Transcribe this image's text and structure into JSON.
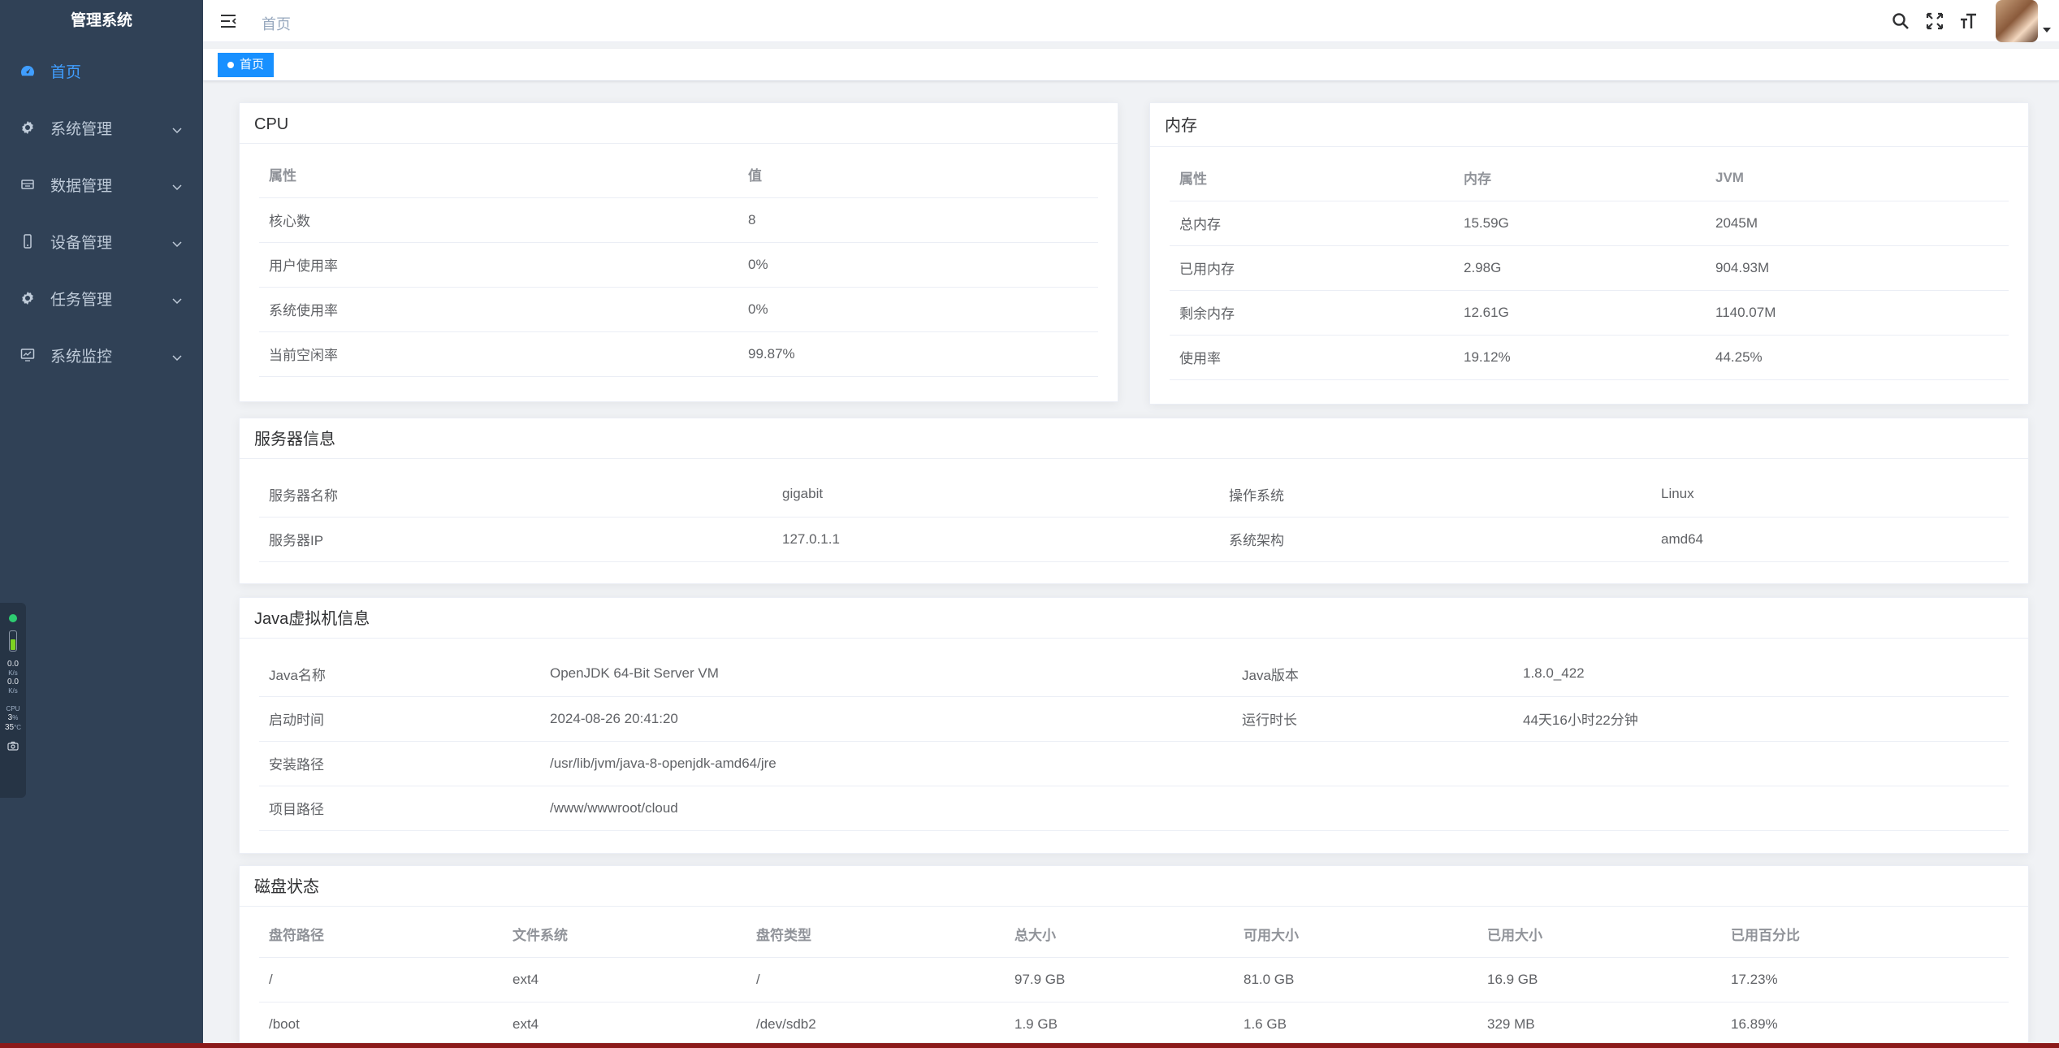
{
  "sidebar": {
    "logo": "管理系统",
    "items": [
      {
        "label": "首页",
        "icon": "dashboard-icon"
      },
      {
        "label": "系统管理",
        "icon": "gear-icon"
      },
      {
        "label": "数据管理",
        "icon": "database-icon"
      },
      {
        "label": "设备管理",
        "icon": "phone-icon"
      },
      {
        "label": "任务管理",
        "icon": "gear-icon"
      },
      {
        "label": "系统监控",
        "icon": "monitor-icon"
      }
    ]
  },
  "widget": {
    "up": "0.0",
    "up_unit": "K/s",
    "down": "0.0",
    "down_unit": "K/s",
    "cpu_label": "CPU",
    "cpu_value": "3",
    "cpu_unit": "%",
    "temp": "35",
    "temp_unit": "°C"
  },
  "header": {
    "breadcrumb": "首页",
    "tag": "首页"
  },
  "cpu": {
    "title": "CPU",
    "headers": [
      "属性",
      "值"
    ],
    "rows": [
      [
        "核心数",
        "8"
      ],
      [
        "用户使用率",
        "0%"
      ],
      [
        "系统使用率",
        "0%"
      ],
      [
        "当前空闲率",
        "99.87%"
      ]
    ]
  },
  "memory": {
    "title": "内存",
    "headers": [
      "属性",
      "内存",
      "JVM"
    ],
    "rows": [
      [
        "总内存",
        "15.59G",
        "2045M"
      ],
      [
        "已用内存",
        "2.98G",
        "904.93M"
      ],
      [
        "剩余内存",
        "12.61G",
        "1140.07M"
      ],
      [
        "使用率",
        "19.12%",
        "44.25%"
      ]
    ]
  },
  "server": {
    "title": "服务器信息",
    "rows": [
      [
        "服务器名称",
        "gigabit",
        "操作系统",
        "Linux"
      ],
      [
        "服务器IP",
        "127.0.1.1",
        "系统架构",
        "amd64"
      ]
    ]
  },
  "jvm": {
    "title": "Java虚拟机信息",
    "rows": [
      [
        "Java名称",
        "OpenJDK 64-Bit Server VM",
        "Java版本",
        "1.8.0_422"
      ],
      [
        "启动时间",
        "2024-08-26 20:41:20",
        "运行时长",
        "44天16小时22分钟"
      ]
    ],
    "install_label": "安装路径",
    "install_value": "/usr/lib/jvm/java-8-openjdk-amd64/jre",
    "project_label": "项目路径",
    "project_value": "/www/wwwroot/cloud"
  },
  "disk": {
    "title": "磁盘状态",
    "headers": [
      "盘符路径",
      "文件系统",
      "盘符类型",
      "总大小",
      "可用大小",
      "已用大小",
      "已用百分比"
    ],
    "rows": [
      [
        "/",
        "ext4",
        "/",
        "97.9 GB",
        "81.0 GB",
        "16.9 GB",
        "17.23%"
      ],
      [
        "/boot",
        "ext4",
        "/dev/sdb2",
        "1.9 GB",
        "1.6 GB",
        "329 MB",
        "16.89%"
      ]
    ]
  }
}
